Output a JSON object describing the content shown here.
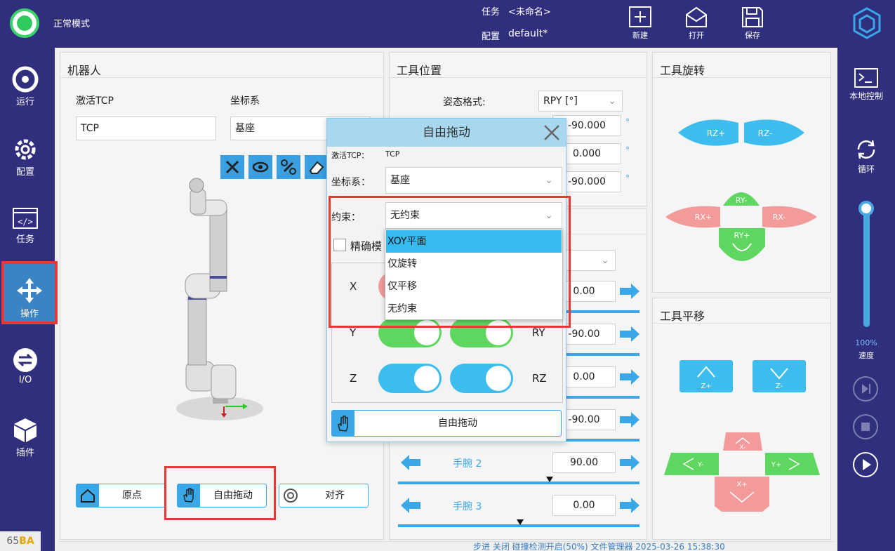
{
  "topbar": {
    "mode": "正常模式",
    "task_label": "任务",
    "task_value": "<未命名>",
    "config_label": "配置",
    "config_value": "default*",
    "btn_new": "新建",
    "btn_open": "打开",
    "btn_save": "保存"
  },
  "leftnav": {
    "items": [
      {
        "label": "运行",
        "icon": "run-icon"
      },
      {
        "label": "配置",
        "icon": "gear-icon"
      },
      {
        "label": "任务",
        "icon": "code-icon"
      },
      {
        "label": "操作",
        "icon": "move-icon"
      },
      {
        "label": "I/O",
        "icon": "io-icon"
      },
      {
        "label": "插件",
        "icon": "cube-icon"
      }
    ],
    "active": "操作",
    "version_prefix": "65",
    "version_suffix": "BA"
  },
  "rightnav": {
    "local_control": "本地控制",
    "loop": "循环",
    "speed_value": "100%",
    "speed_label": "速度",
    "speed_level": 1.0
  },
  "robot_panel": {
    "title": "机器人",
    "tcp_label": "激活TCP",
    "tcp_value": "TCP",
    "coord_label": "坐标系",
    "coord_value": "基座",
    "btn_home": "原点",
    "btn_freedrive": "自由拖动",
    "btn_align": "对齐"
  },
  "tool_pos_panel": {
    "title": "工具位置",
    "pose_format_label": "姿态格式:",
    "pose_format_value": "RPY [°]",
    "rot_values": [
      "-90.000",
      "0.000",
      "-90.000"
    ],
    "degree_unit": "°",
    "joint_values": [
      "0.00",
      "-90.00",
      "0.00",
      "-90.00"
    ],
    "wrist2_label": "手腕 2",
    "wrist2_value": "90.00",
    "wrist3_label": "手腕 3",
    "wrist3_value": "0.00"
  },
  "tool_rot_panel": {
    "title": "工具旋转",
    "rz_plus": "RZ+",
    "rz_minus": "RZ-",
    "ry_minus": "RY-",
    "ry_plus": "RY+",
    "rx_plus": "RX+",
    "rx_minus": "RX-"
  },
  "tool_trans_panel": {
    "title": "工具平移",
    "z_plus": "Z+",
    "z_minus": "Z-",
    "x_minus": "X-",
    "x_plus": "X+",
    "y_minus": "Y-",
    "y_plus": "Y+"
  },
  "dialog": {
    "title": "自由拖动",
    "tcp_label": "激活TCP：",
    "tcp_value": "TCP",
    "coord_label": "坐标系：",
    "coord_value": "基座",
    "constraint_label": "约束：",
    "constraint_value": "无约束",
    "precise_label": "精确模",
    "axis_x": "X",
    "axis_y": "Y",
    "axis_z": "Z",
    "axis_ry": "RY",
    "axis_rz": "RZ",
    "freedrive_button": "自由拖动",
    "options": [
      "XOY平面",
      "仅旋转",
      "仅平移",
      "无约束"
    ],
    "selected_option": "XOY平面"
  },
  "statusbar": {
    "text": "步进 关闭   碰撞检测开启(50%)   文件管理器   2025-03-26 15:38:30"
  },
  "colors": {
    "nav_bg": "#2f2f7e",
    "accent": "#3aa8e8",
    "rot_blue": "#3dbdee",
    "pink": "#f39a9a",
    "green": "#5fd65f",
    "highlight_red": "#e53935"
  }
}
